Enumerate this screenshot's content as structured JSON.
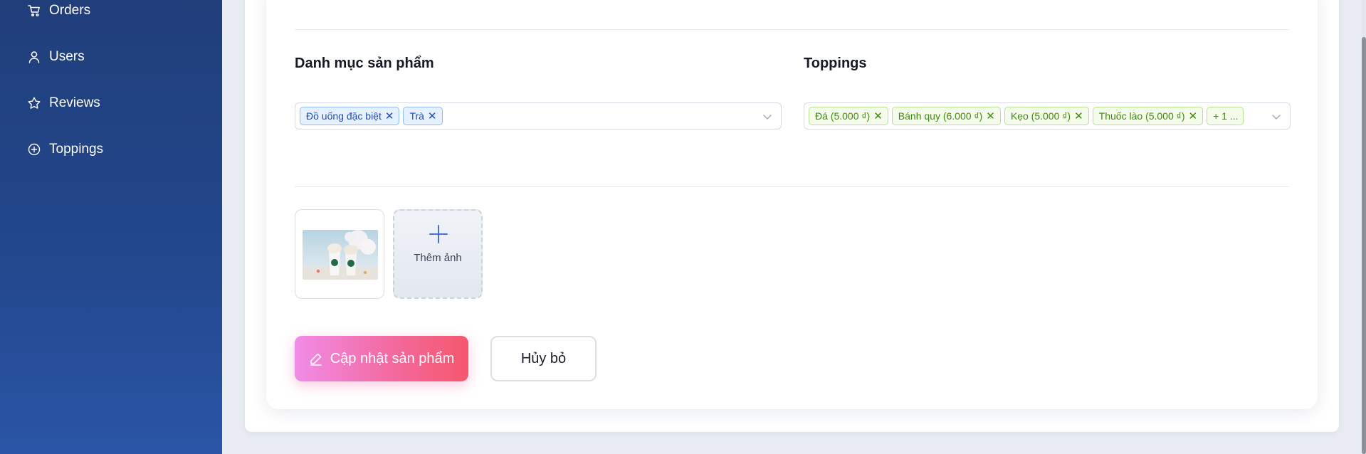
{
  "sidebar": {
    "items": [
      {
        "label": "Orders",
        "icon": "cart-icon"
      },
      {
        "label": "Users",
        "icon": "user-icon"
      },
      {
        "label": "Reviews",
        "icon": "star-icon"
      },
      {
        "label": "Toppings",
        "icon": "plus-circle-icon"
      }
    ]
  },
  "form": {
    "category": {
      "label": "Danh mục sản phẩm",
      "tags": [
        "Đồ uống đặc biệt",
        "Trà"
      ]
    },
    "toppings": {
      "label": "Toppings",
      "tags": [
        "Đá (5.000 ₫)",
        "Bánh quy (6.000 ₫)",
        "Kẹo (5.000 ₫)",
        "Thuốc lào (5.000 ₫)"
      ],
      "more": "+ 1 ..."
    },
    "images": {
      "add_label": "Thêm ảnh"
    },
    "actions": {
      "submit_label": "Cập nhật sản phẩm",
      "cancel_label": "Hủy bỏ"
    }
  },
  "colors": {
    "sidebar_bg": "#23488e",
    "category_tag": "#1f4fb0",
    "topping_tag": "#3f8a12",
    "primary_gradient_start": "#f18ce8",
    "primary_gradient_end": "#f5576c"
  }
}
